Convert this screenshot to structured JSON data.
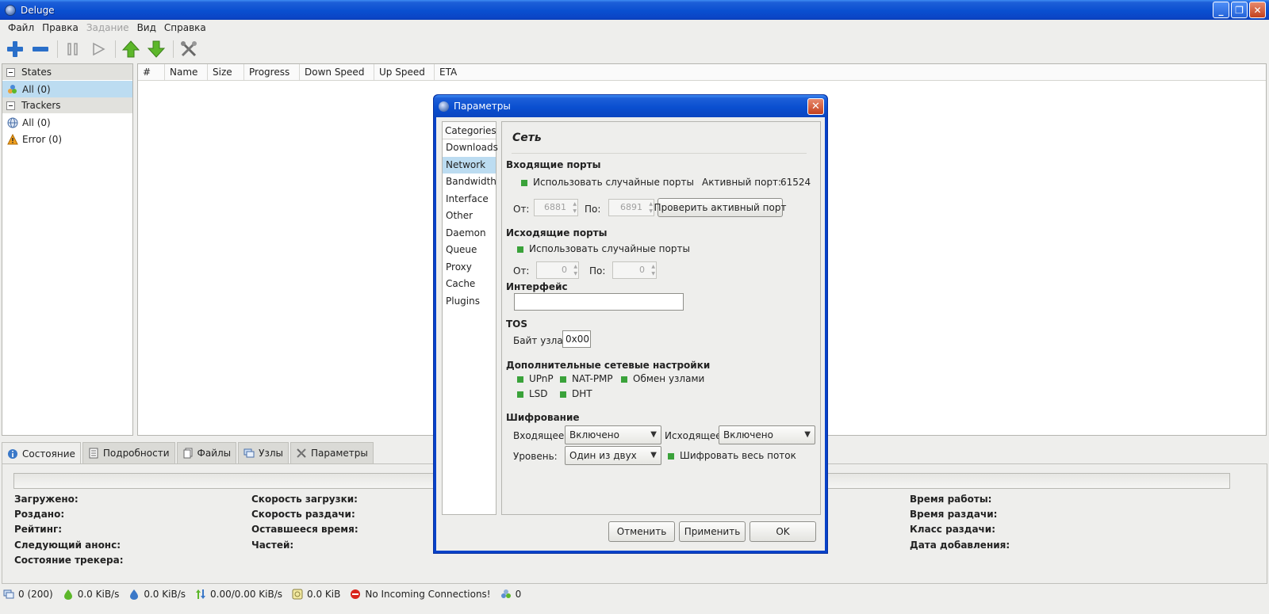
{
  "window": {
    "title": "Deluge"
  },
  "menu": [
    "Файл",
    "Правка",
    "Задание",
    "Вид",
    "Справка"
  ],
  "sidebar": {
    "states_header": "States",
    "states_all": "All (0)",
    "trackers_header": "Trackers",
    "trackers_all": "All (0)",
    "trackers_error": "Error (0)"
  },
  "columns": [
    "#",
    "Name",
    "Size",
    "Progress",
    "Down Speed",
    "Up Speed",
    "ETA"
  ],
  "tabs": [
    "Состояние",
    "Подробности",
    "Файлы",
    "Узлы",
    "Параметры"
  ],
  "details": {
    "col1": [
      "Загружено:",
      "Роздано:",
      "Рейтинг:",
      "Следующий анонс:",
      "Состояние трекера:"
    ],
    "col2": [
      "Скорость загрузки:",
      "Скорость раздачи:",
      "Оставшееся время:",
      "Частей:"
    ],
    "col3": [
      "Время работы:",
      "Время раздачи:",
      "Класс раздачи:",
      "Дата добавления:"
    ]
  },
  "statusbar": {
    "connections": "0 (200)",
    "down": "0.0 KiB/s",
    "up": "0.0 KiB/s",
    "protocol": "0.00/0.00 KiB/s",
    "disk": "0.0 KiB",
    "incoming": "No Incoming Connections!",
    "dht": "0"
  },
  "dialog": {
    "title": "Параметры",
    "categories_header": "Categories",
    "categories": [
      "Downloads",
      "Network",
      "Bandwidth",
      "Interface",
      "Other",
      "Daemon",
      "Queue",
      "Proxy",
      "Cache",
      "Plugins"
    ],
    "selected_category": "Network",
    "heading": "Сеть",
    "incoming_ports": "Входящие порты",
    "use_random_in": "Использовать случайные порты",
    "active_port_label": "Активный порт:",
    "active_port_value": "61524",
    "from_label": "От:",
    "to_label": "По:",
    "in_from_value": "6881",
    "in_to_value": "6891",
    "test_port_button": "Проверить активный порт",
    "outgoing_ports": "Исходящие порты",
    "use_random_out": "Использовать случайные порты",
    "out_from_value": "0",
    "out_to_value": "0",
    "interface_label": "Интерфейс",
    "interface_value": "",
    "tos_label": "TOS",
    "peer_tos_label": "Байт узла:",
    "peer_tos_value": "0x00",
    "network_extras": "Дополнительные сетевые настройки",
    "upnp": "UPnP",
    "natpmp": "NAT-PMP",
    "pex": "Обмен узлами",
    "lsd": "LSD",
    "dht": "DHT",
    "encryption": "Шифрование",
    "incoming_enc_label": "Входящее:",
    "incoming_enc_value": "Включено",
    "outgoing_enc_label": "Исходящее:",
    "outgoing_enc_value": "Включено",
    "level_label": "Уровень:",
    "level_value": "Один из двух",
    "encrypt_all": "Шифровать весь поток",
    "cancel": "Отменить",
    "apply": "Применить",
    "ok": "OK"
  },
  "colors": {
    "accent": "#0842c8",
    "selection": "#bcdcf1",
    "check": "#3aa23a"
  }
}
